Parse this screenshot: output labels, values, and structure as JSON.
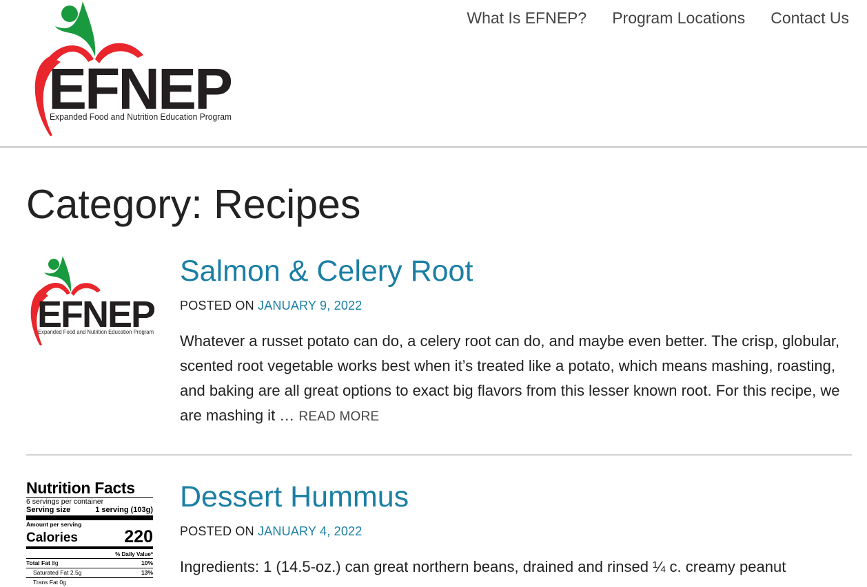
{
  "logo": {
    "wordmark": "EFNEP",
    "tagline": "Expanded Food and Nutrition Education Program"
  },
  "nav": [
    {
      "label": "What Is EFNEP?"
    },
    {
      "label": "Program Locations"
    },
    {
      "label": "Contact Us"
    }
  ],
  "page_title": "Category: Recipes",
  "posts": [
    {
      "title": "Salmon & Celery Root",
      "posted_on": "POSTED ON",
      "date": "JANUARY 9, 2022",
      "excerpt": "Whatever a russet potato can do, a celery root can do, and maybe even better. The crisp, globular, scented root vegetable works best when it’s treated like a potato, which means mashing, roasting, and baking are all great options to exact big flavors from this lesser known root. For this recipe, we are mashing it … ",
      "read_more": "READ MORE"
    },
    {
      "title": "Dessert Hummus",
      "posted_on": "POSTED ON",
      "date": "JANUARY 4, 2022",
      "excerpt": "Ingredients: 1 (14.5-oz.) can great northern beans, drained and rinsed ¼ c. creamy peanut"
    }
  ],
  "nutrition": {
    "title": "Nutrition Facts",
    "servings": "6 servings per container",
    "serving_size_label": "Serving size",
    "serving_size_value": "1 serving (103g)",
    "amount_per_serving": "Amount per serving",
    "calories_label": "Calories",
    "calories_value": "220",
    "daily_value": "% Daily Value*",
    "total_fat_label": "Total Fat",
    "total_fat_amount": "8g",
    "total_fat_pct": "10%",
    "sat_fat_label": "Saturated Fat 2.5g",
    "sat_fat_pct": "13%",
    "trans_fat_label": "Trans Fat 0g"
  },
  "colors": {
    "link": "#1b7fa4",
    "logo_red": "#e8262b",
    "logo_green": "#1a9a3f",
    "logo_text": "#231f20"
  }
}
